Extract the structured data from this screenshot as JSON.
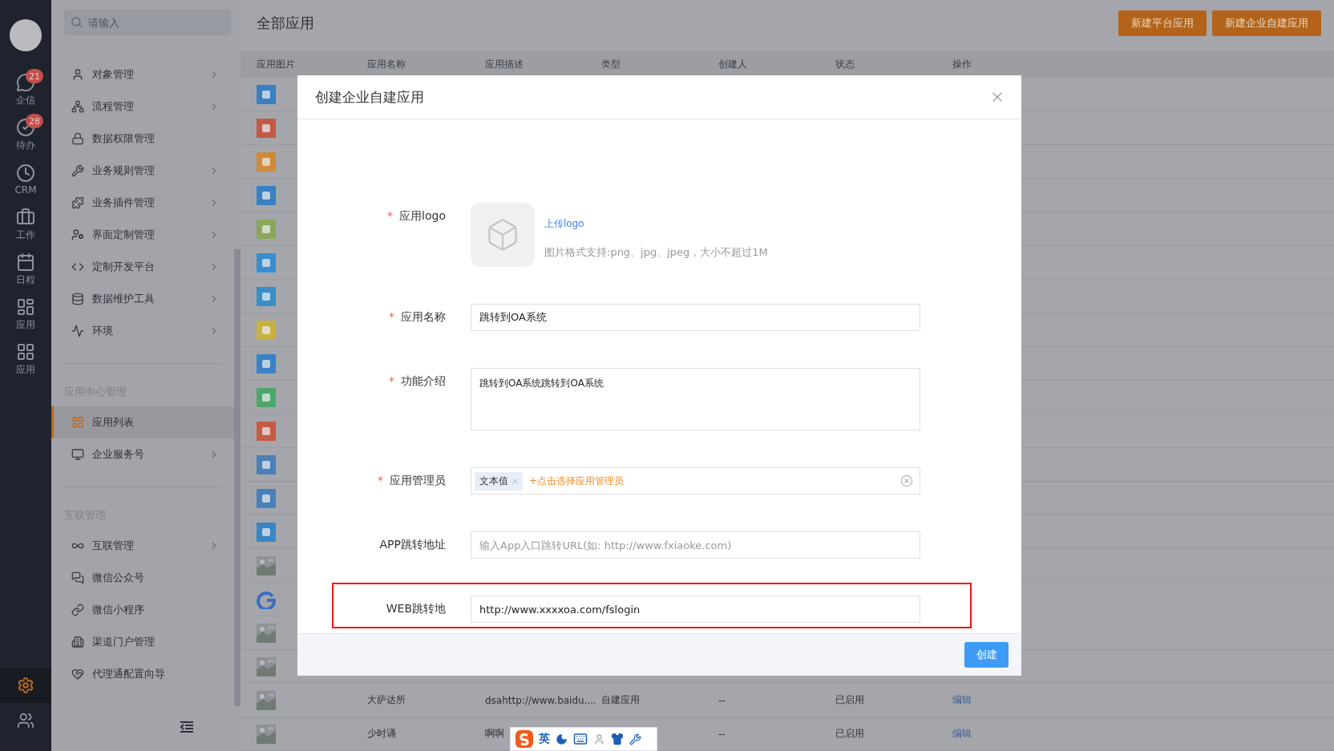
{
  "rail": {
    "items": [
      {
        "label": "企信",
        "badge": "21"
      },
      {
        "label": "待办",
        "badge": "28"
      },
      {
        "label": "CRM"
      },
      {
        "label": "工作"
      },
      {
        "label": "日程"
      },
      {
        "label": "应用"
      },
      {
        "label": "应用"
      }
    ],
    "bottom": [
      {
        "selected": true
      },
      {
        "selected": false
      }
    ]
  },
  "sidebar": {
    "search": {
      "placeholder": "请输入"
    },
    "sections": [
      {
        "items": [
          {
            "label": "对象管理",
            "submenu": true,
            "selected": false
          },
          {
            "label": "流程管理",
            "submenu": true,
            "selected": false
          },
          {
            "label": "数据权限管理",
            "submenu": false,
            "selected": false
          },
          {
            "label": "业务规则管理",
            "submenu": true,
            "selected": false
          },
          {
            "label": "业务插件管理",
            "submenu": true,
            "selected": false
          },
          {
            "label": "界面定制管理",
            "submenu": true,
            "selected": false
          },
          {
            "label": "定制开发平台",
            "submenu": true,
            "selected": false
          },
          {
            "label": "数据维护工具",
            "submenu": true,
            "selected": false
          },
          {
            "label": "环境",
            "submenu": true,
            "selected": false
          }
        ]
      },
      {
        "title": "应用中心管理",
        "items": [
          {
            "label": "应用列表",
            "submenu": false,
            "selected": true
          },
          {
            "label": "企业服务号",
            "submenu": true,
            "selected": false
          }
        ]
      },
      {
        "title": "互联管理",
        "items": [
          {
            "label": "互联管理",
            "submenu": true,
            "selected": false
          },
          {
            "label": "微信公众号",
            "submenu": false,
            "selected": false
          },
          {
            "label": "微信小程序",
            "submenu": false,
            "selected": false
          },
          {
            "label": "渠道门户管理",
            "submenu": false,
            "selected": false
          },
          {
            "label": "代理通配置向导",
            "submenu": false,
            "selected": false
          }
        ]
      }
    ]
  },
  "main": {
    "title": "全部应用",
    "buttons": [
      "新建平台应用",
      "新建企业自建应用"
    ],
    "table": {
      "columns": [
        "应用图片",
        "应用名称",
        "应用描述",
        "类型",
        "创建人",
        "状态",
        "操作"
      ],
      "rows": [
        {
          "image": {
            "kind": "tile",
            "color": "#3a7fc2"
          }
        },
        {
          "image": {
            "kind": "tile",
            "color": "#c25a45"
          }
        },
        {
          "image": {
            "kind": "tile",
            "color": "#d08a3a"
          }
        },
        {
          "image": {
            "kind": "tile",
            "color": "#3a7fc2"
          }
        },
        {
          "image": {
            "kind": "tile",
            "color": "#8aa75a"
          }
        },
        {
          "image": {
            "kind": "tile",
            "color": "#3a8ed0"
          }
        },
        {
          "image": {
            "kind": "tile",
            "color": "#3a8ec8"
          }
        },
        {
          "image": {
            "kind": "tile",
            "color": "#c9b040"
          }
        },
        {
          "image": {
            "kind": "tile",
            "color": "#3a82c8"
          }
        },
        {
          "image": {
            "kind": "tile",
            "color": "#4da66a"
          }
        },
        {
          "image": {
            "kind": "tile",
            "color": "#c65a45"
          }
        },
        {
          "image": {
            "kind": "tile",
            "color": "#4a7fb8"
          }
        },
        {
          "image": {
            "kind": "tile",
            "color": "#4a80b9"
          }
        },
        {
          "image": {
            "kind": "tile",
            "color": "#3a85c5"
          }
        },
        {
          "image": {
            "kind": "picture"
          }
        },
        {
          "image": {
            "kind": "arc"
          }
        },
        {
          "image": {
            "kind": "picture"
          }
        },
        {
          "image": {
            "kind": "picture"
          }
        },
        {
          "image": {
            "kind": "picture"
          },
          "name": "大萨达所",
          "description": "dsahttp://www.baidu....",
          "type": "自建应用",
          "creator": "--",
          "status": "已启用",
          "action": "编辑"
        },
        {
          "image": {
            "kind": "picture"
          },
          "name": "少时诵",
          "description": "啊啊",
          "creator": "--",
          "status": "已启用",
          "action": "编辑"
        }
      ]
    }
  },
  "dialog": {
    "title": "创建企业自建应用",
    "fields": [
      {
        "kind": "logo",
        "label": "应用logo",
        "mark": "*",
        "link": "上传logo",
        "hint": "图片格式支持:png、jpg、jpeg，大小不超过1M",
        "highlighted": false
      },
      {
        "kind": "text",
        "label": "应用名称",
        "mark": "*",
        "value": "跳转到OA系统",
        "highlighted": false
      },
      {
        "kind": "textarea",
        "label": "功能介绍",
        "mark": "*",
        "value": "跳转到OA系统跳转到OA系统",
        "highlighted": false
      },
      {
        "kind": "tags",
        "label": "应用管理员",
        "mark": "*",
        "tags": [
          "文本值"
        ],
        "add_label": "+点击选择应用管理员",
        "highlighted": false
      },
      {
        "kind": "text",
        "label": "APP跳转地址",
        "placeholder": "输入App入口跳转URL(如: http://www.fxiaoke.com)",
        "highlighted": false
      },
      {
        "kind": "text",
        "label": "WEB跳转地",
        "value": "http://www.xxxxoa.com/fslogin",
        "highlighted": true
      }
    ],
    "submit": "创建"
  },
  "ime_toolbar": {
    "mode": "英"
  }
}
